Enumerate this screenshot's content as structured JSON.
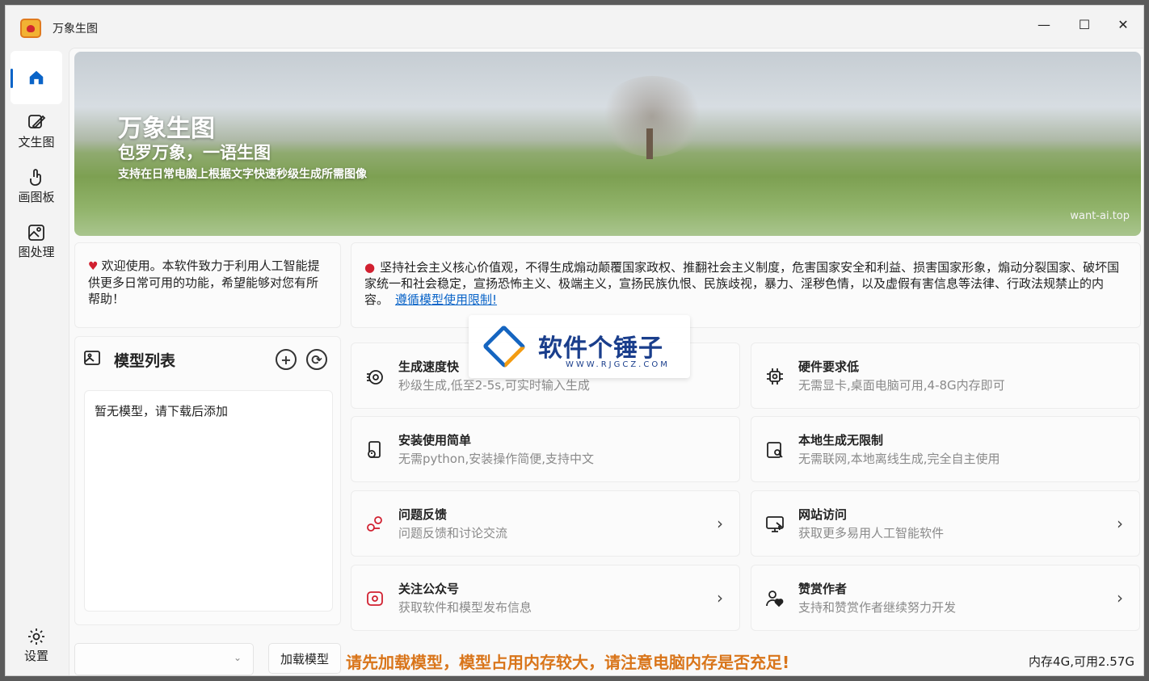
{
  "window": {
    "title": "万象生图",
    "controls": {
      "minimize": "—",
      "maximize": "☐",
      "close": "✕"
    }
  },
  "sidebar": {
    "items": [
      {
        "label": "",
        "icon": "home-icon"
      },
      {
        "label": "文生图",
        "icon": "image-edit-icon"
      },
      {
        "label": "画图板",
        "icon": "touch-draw-icon"
      },
      {
        "label": "图处理",
        "icon": "image-process-icon"
      }
    ],
    "settings": {
      "label": "设置",
      "icon": "gear-icon"
    }
  },
  "banner": {
    "title": "万象生图",
    "subtitle": "包罗万象，一语生图",
    "desc": "支持在日常电脑上根据文字快速秒级生成所需图像",
    "url": "want-ai.top"
  },
  "welcome": {
    "text": "欢迎使用。本软件致力于利用人工智能提供更多日常可用的功能，希望能够对您有所帮助！"
  },
  "notice": {
    "text": "坚持社会主义核心价值观，不得生成煽动颠覆国家政权、推翻社会主义制度，危害国家安全和利益、损害国家形象，煽动分裂国家、破坏国家统一和社会稳定，宣扬恐怖主义、极端主义，宣扬民族仇恨、民族歧视，暴力、淫秽色情，以及虚假有害信息等法律、行政法规禁止的内容。",
    "link": "遵循模型使用限制!"
  },
  "models": {
    "title": "模型列表",
    "add": "+",
    "refresh": "⟳",
    "empty": "暂无模型，请下载后添加"
  },
  "features": [
    {
      "title": "生成速度快",
      "desc": "秒级生成,低至2-5s,可实时输入生成",
      "icon": "speed-icon"
    },
    {
      "title": "硬件要求低",
      "desc": "无需显卡,桌面电脑可用,4-8G内存即可",
      "icon": "chip-icon"
    },
    {
      "title": "安装使用简单",
      "desc": "无需python,安装操作简便,支持中文",
      "icon": "install-icon"
    },
    {
      "title": "本地生成无限制",
      "desc": "无需联网,本地离线生成,完全自主使用",
      "icon": "local-icon"
    },
    {
      "title": "问题反馈",
      "desc": "问题反馈和讨论交流",
      "icon": "feedback-icon",
      "chevron": "›"
    },
    {
      "title": "网站访问",
      "desc": "获取更多易用人工智能软件",
      "icon": "website-icon",
      "chevron": "›"
    },
    {
      "title": "关注公众号",
      "desc": "获取软件和模型发布信息",
      "icon": "wechat-icon",
      "chevron": "›"
    },
    {
      "title": "赞赏作者",
      "desc": "支持和赞赏作者继续努力开发",
      "icon": "reward-icon",
      "chevron": "›"
    }
  ],
  "bottom": {
    "select_value": "",
    "caret": "⌄",
    "load_button": "加载模型",
    "warning": "请先加载模型，模型占用内存较大，请注意电脑内存是否充足!",
    "memory": "内存4G,可用2.57G"
  },
  "watermark": {
    "title": "软件个锤子",
    "sub": "WWW.RJGCZ.COM"
  }
}
